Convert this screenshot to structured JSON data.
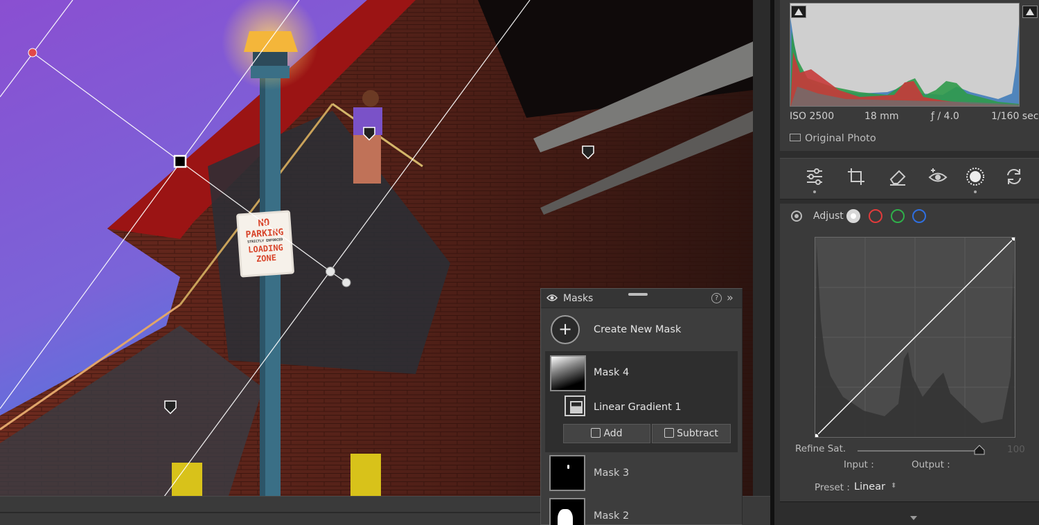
{
  "masks_panel": {
    "title": "Masks",
    "help": "?",
    "collapse": "»",
    "create_icon": "+",
    "create_label": "Create New Mask",
    "masks": [
      {
        "name": "Mask 4",
        "selected": true,
        "component": "Linear Gradient 1"
      },
      {
        "name": "Mask 3",
        "selected": false
      },
      {
        "name": "Mask 2",
        "selected": false
      }
    ],
    "add_label": "Add",
    "subtract_label": "Subtract"
  },
  "histogram": {
    "iso": "ISO 2500",
    "focal_length": "18 mm",
    "aperture": "ƒ / 4.0",
    "shutter": "1/160 sec",
    "original_photo": "Original Photo"
  },
  "tools": [
    "sliders-icon",
    "crop-icon",
    "eraser-icon",
    "redeye-icon",
    "masking-icon",
    "presets-icon"
  ],
  "curve_panel": {
    "adjust_label": "Adjust",
    "channels": [
      {
        "name": "white-channel",
        "color": "#d8d8d8"
      },
      {
        "name": "red-channel",
        "color": "#e23b3b"
      },
      {
        "name": "green-channel",
        "color": "#2fb04a"
      },
      {
        "name": "blue-channel",
        "color": "#2f6fe0"
      }
    ],
    "refine_label": "Refine Sat.",
    "refine_value": "100",
    "input_label": "Input :",
    "output_label": "Output :",
    "preset_label": "Preset :",
    "preset_value": "Linear"
  },
  "photo_sign": {
    "line1": "NO",
    "line2": "PARKING",
    "line3": "STRICTLY ENFORCED",
    "line4": "LOADING",
    "line5": "ZONE"
  }
}
